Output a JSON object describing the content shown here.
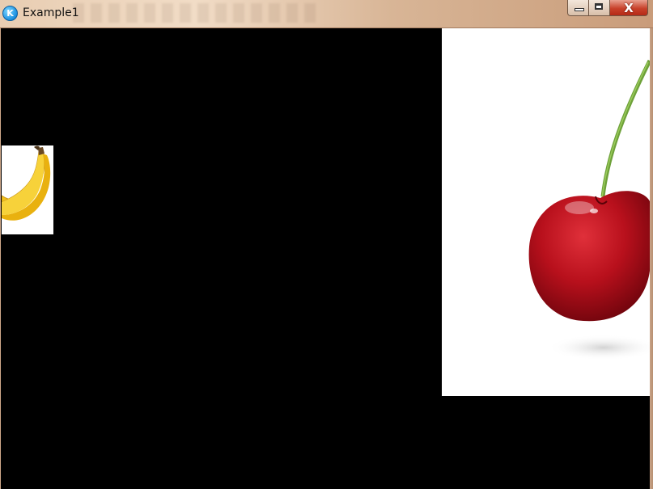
{
  "window": {
    "title": "Example1",
    "app_icon": "kivy-icon",
    "controls": {
      "minimize_icon": "minimize-icon",
      "maximize_icon": "maximize-icon",
      "close_icon": "close-icon",
      "close_glyph": "X"
    }
  },
  "canvas": {
    "background": "#000000",
    "images": [
      {
        "name": "banana-image",
        "icon": "banana"
      },
      {
        "name": "cherry-image",
        "icon": "cherry"
      }
    ]
  },
  "colors": {
    "titlebar": "#e8cdb2",
    "close_button": "#c8412b",
    "banana_yellow": "#f2c21b",
    "cherry_red": "#c0101c",
    "stem_green": "#6ea13a"
  }
}
